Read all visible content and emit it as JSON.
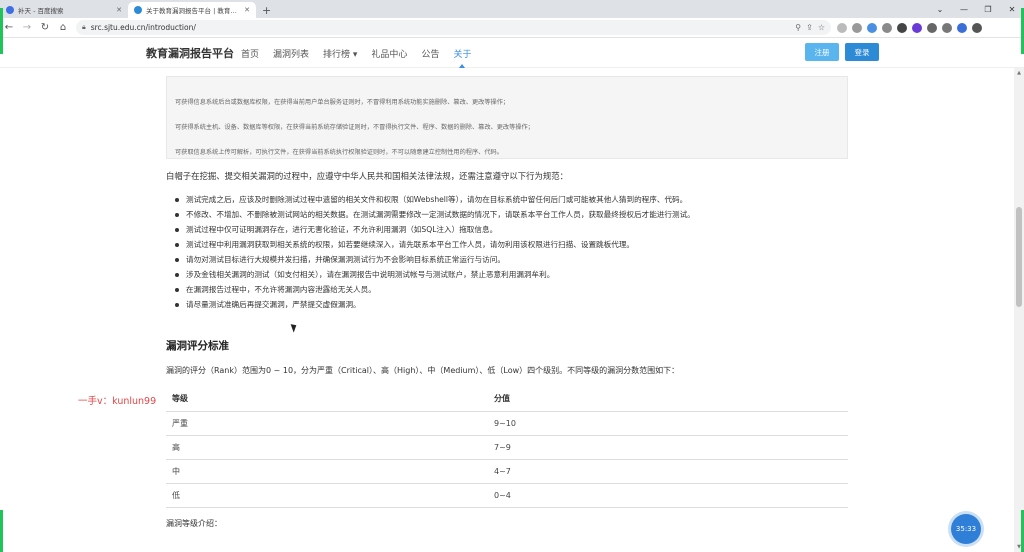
{
  "browser": {
    "tabs": [
      {
        "title": "补天 - 百度搜索",
        "color": "#3f6fe0",
        "active": false
      },
      {
        "title": "关于教育漏洞报告平台 | 教育漏洞报告平台",
        "color": "#2d8ad6",
        "active": true
      }
    ],
    "new_tab": "+",
    "url": "src.sjtu.edu.cn/introduction/",
    "controls": {
      "minimize": "—",
      "restore": "❐",
      "close": "✕",
      "chevron": "⌄"
    }
  },
  "site": {
    "logo": "教育漏洞报告平台",
    "nav": [
      {
        "label": "首页",
        "active": false
      },
      {
        "label": "漏洞列表",
        "active": false
      },
      {
        "label": "排行榜 ▾",
        "active": false
      },
      {
        "label": "礼品中心",
        "active": false
      },
      {
        "label": "公告",
        "active": false
      },
      {
        "label": "关于",
        "active": true
      }
    ],
    "register": "注册",
    "login": "登录",
    "accent": "#2d8ad6"
  },
  "content": {
    "greybox_lines": [
      "可获得信息系统后台或数据库权限，在获得当前用户单台服务证则时，不冒得利用系统功能实施删除、篡改、更改等操作；",
      "可获得系统主机、设备、数据库等权限，在获得当前系统存储验证则时，不冒得执行文件、程序、数据的删除、篡改、更改等操作；",
      "可获取信息系统上传可解析，可执行文件，在获得当前系统执行权限验证则时，不可以随意建立控制性用的程序、代码。"
    ],
    "intro": "白帽子在挖掘、提交相关漏洞的过程中，应遵守中华人民共和国相关法律法规，还需注意遵守以下行为规范：",
    "rules": [
      "测试完成之后，应该及时删除测试过程中遗留的相关文件和权限（如Webshell等），请勿在目标系统中留任何后门或可能被其他人猜到的程序、代码。",
      "不修改、不增加、不删除被测试网站的相关数据。在测试漏洞需要修改一定测试数据的情况下，请联系本平台工作人员，获取最终授权后才能进行测试。",
      "测试过程中仅可证明漏洞存在，进行无害化验证，不允许利用漏洞（如SQL注入）拖取信息。",
      "测试过程中利用漏洞获取到相关系统的权限，如若要继续深入，请先联系本平台工作人员，请勿利用该权限进行扫描、设置跳板代理。",
      "请勿对测试目标进行大规模并发扫描，并确保漏洞测试行为不会影响目标系统正常运行与访问。",
      "涉及金钱相关漏洞的测试（如支付相关），请在漏洞报告中说明测试帐号与测试账户，禁止恶意利用漏洞牟利。",
      "在漏洞报告过程中，不允许将漏洞内容泄露给无关人员。",
      "请尽量测试准确后再提交漏洞，严禁提交虚假漏洞。"
    ],
    "section_title": "漏洞评分标准",
    "rank_desc": "漏洞的评分（Rank）范围为0 ~ 10，分为严重（Critical）、高（High）、中（Medium）、低（Low）四个级别。不同等级的漏洞分数范围如下：",
    "watermark": "一手v：kunlun99",
    "table": {
      "headers": [
        "等级",
        "分值"
      ],
      "rows": [
        [
          "严重",
          "9~10"
        ],
        [
          "高",
          "7~9"
        ],
        [
          "中",
          "4~7"
        ],
        [
          "低",
          "0~4"
        ]
      ]
    },
    "level_intro": "漏洞等级介绍：",
    "timer": "35:33"
  }
}
